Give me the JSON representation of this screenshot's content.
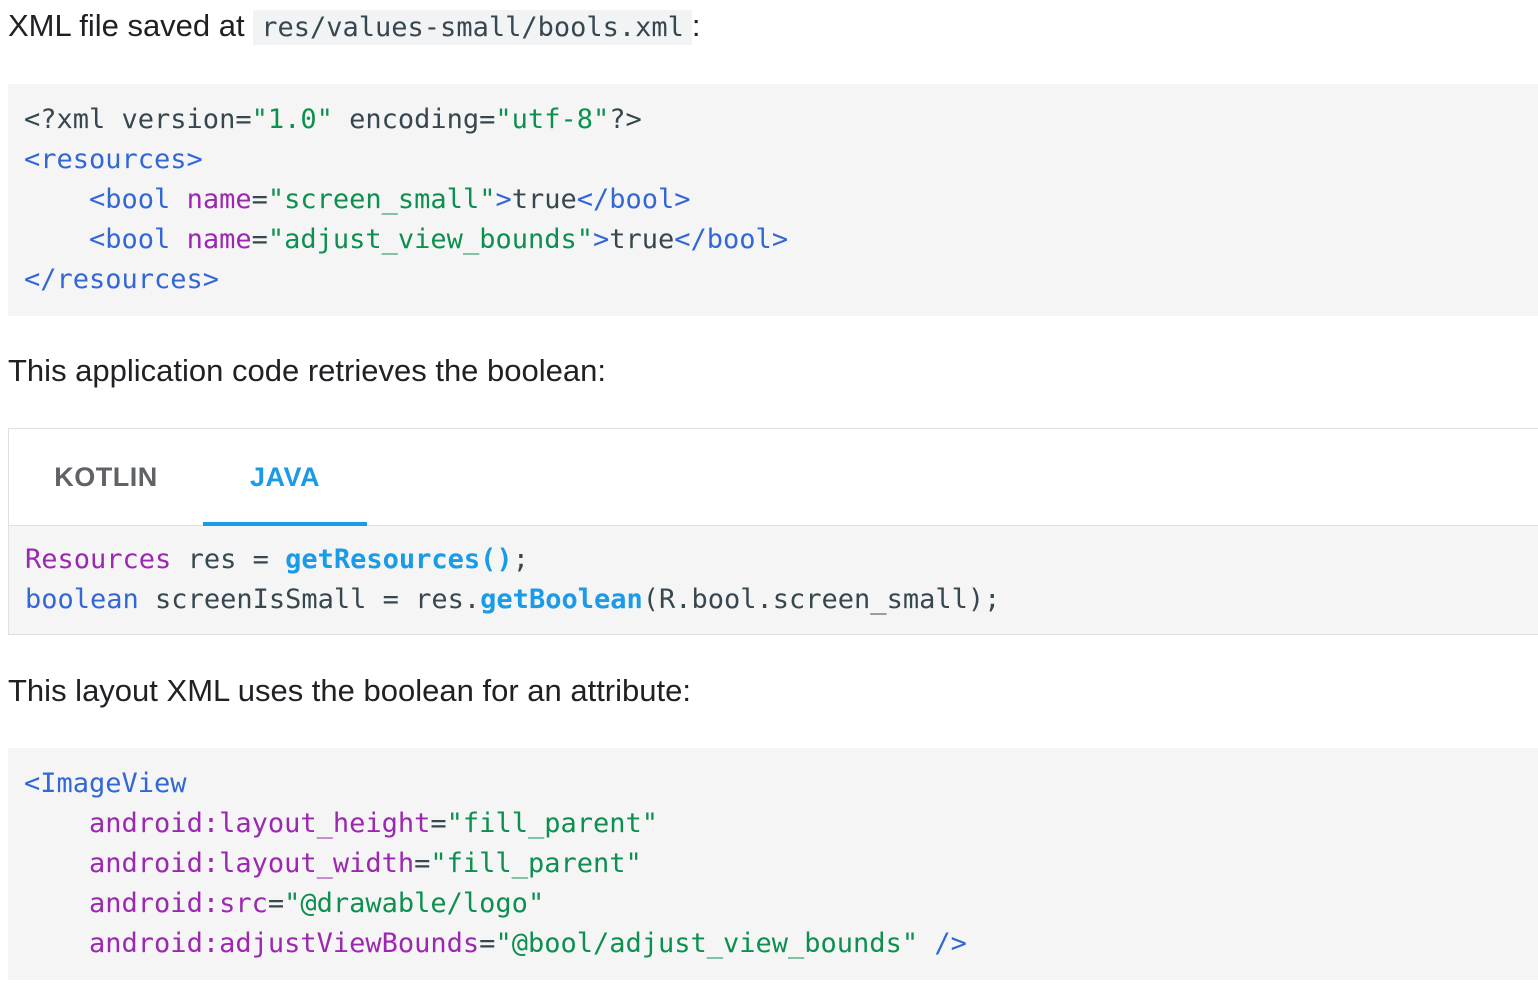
{
  "intro": {
    "prefix": "XML file saved at ",
    "path": "res/values-small/bools.xml",
    "suffix": ":"
  },
  "xml_block": {
    "lines": [
      [
        [
          "plain",
          "<?xml version="
        ],
        [
          "str",
          "\"1.0\""
        ],
        [
          "plain",
          " encoding="
        ],
        [
          "str",
          "\"utf-8\""
        ],
        [
          "plain",
          "?>"
        ]
      ],
      [
        [
          "tag",
          "<resources>"
        ]
      ],
      [
        [
          "plain",
          "    "
        ],
        [
          "tag",
          "<bool"
        ],
        [
          "plain",
          " "
        ],
        [
          "attr",
          "name"
        ],
        [
          "plain",
          "="
        ],
        [
          "str",
          "\"screen_small\""
        ],
        [
          "tag",
          ">"
        ],
        [
          "plain",
          "true"
        ],
        [
          "tag",
          "</bool>"
        ]
      ],
      [
        [
          "plain",
          "    "
        ],
        [
          "tag",
          "<bool"
        ],
        [
          "plain",
          " "
        ],
        [
          "attr",
          "name"
        ],
        [
          "plain",
          "="
        ],
        [
          "str",
          "\"adjust_view_bounds\""
        ],
        [
          "tag",
          ">"
        ],
        [
          "plain",
          "true"
        ],
        [
          "tag",
          "</bool>"
        ]
      ],
      [
        [
          "tag",
          "</resources>"
        ]
      ]
    ]
  },
  "app_code_text": "This application code retrieves the boolean:",
  "tabs": {
    "kotlin_label": "KOTLIN",
    "java_label": "JAVA",
    "selected": "JAVA"
  },
  "java_block": {
    "lines": [
      [
        [
          "type",
          "Resources"
        ],
        [
          "plain",
          " res = "
        ],
        [
          "fn",
          "getResources()"
        ],
        [
          "plain",
          ";"
        ]
      ],
      [
        [
          "kw",
          "boolean"
        ],
        [
          "plain",
          " screenIsSmall = res."
        ],
        [
          "fn",
          "getBoolean"
        ],
        [
          "plain",
          "(R.bool.screen_small);"
        ]
      ]
    ]
  },
  "layout_text": "This layout XML uses the boolean for an attribute:",
  "layout_block": {
    "lines": [
      [
        [
          "tag",
          "<ImageView"
        ]
      ],
      [
        [
          "plain",
          "    "
        ],
        [
          "attr",
          "android:layout_height"
        ],
        [
          "plain",
          "="
        ],
        [
          "str",
          "\"fill_parent\""
        ]
      ],
      [
        [
          "plain",
          "    "
        ],
        [
          "attr",
          "android:layout_width"
        ],
        [
          "plain",
          "="
        ],
        [
          "str",
          "\"fill_parent\""
        ]
      ],
      [
        [
          "plain",
          "    "
        ],
        [
          "attr",
          "android:src"
        ],
        [
          "plain",
          "="
        ],
        [
          "str",
          "\"@drawable/logo\""
        ]
      ],
      [
        [
          "plain",
          "    "
        ],
        [
          "attr",
          "android:adjustViewBounds"
        ],
        [
          "plain",
          "="
        ],
        [
          "str",
          "\"@bool/adjust_view_bounds\""
        ],
        [
          "plain",
          " "
        ],
        [
          "tag",
          "/>"
        ]
      ]
    ]
  },
  "colors": {
    "tag": "#3367d6",
    "attr": "#9c27b0",
    "string": "#0d904f",
    "function": "#1a9be8",
    "tab_active": "#1a9be8",
    "tab_inactive": "#5f6368",
    "code_bg": "#f5f5f5"
  }
}
